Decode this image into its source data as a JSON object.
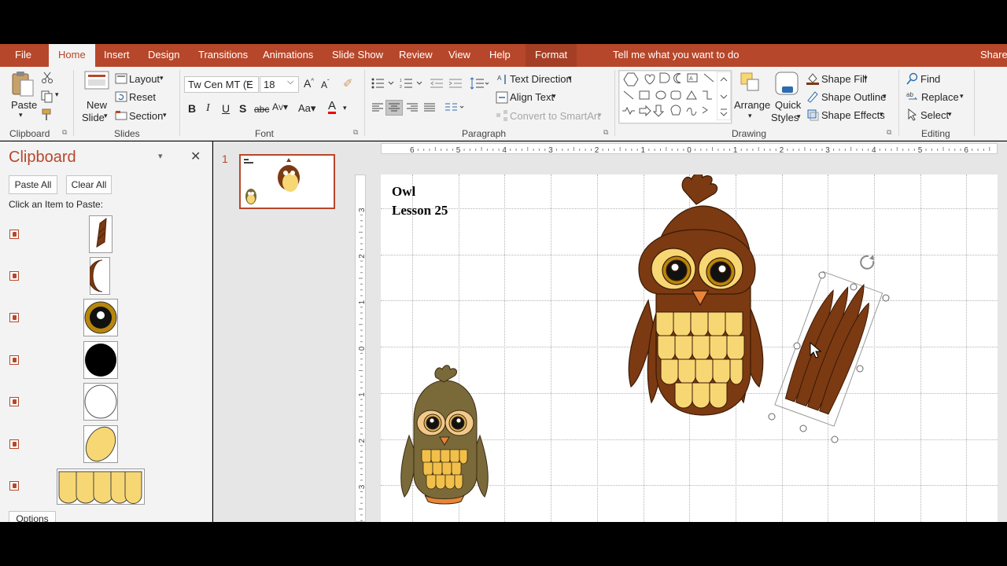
{
  "ribbon_tabs": [
    "File",
    "Home",
    "Insert",
    "Design",
    "Transitions",
    "Animations",
    "Slide Show",
    "Review",
    "View",
    "Help",
    "Format"
  ],
  "active_tab": "Home",
  "tell_me": "Tell me what you want to do",
  "share": "Share",
  "clipboard_group": {
    "paste": "Paste",
    "label": "Clipboard"
  },
  "slides_group": {
    "new_slide_1": "New",
    "new_slide_2": "Slide",
    "layout": "Layout",
    "reset": "Reset",
    "section": "Section",
    "label": "Slides"
  },
  "font_group": {
    "font_name": "Tw Cen MT (E",
    "font_size": "18",
    "label": "Font"
  },
  "paragraph_group": {
    "text_direction": "Text Direction",
    "align_text": "Align Text",
    "smartart": "Convert to SmartArt",
    "label": "Paragraph"
  },
  "drawing_group": {
    "arrange": "Arrange",
    "quick_styles_1": "Quick",
    "quick_styles_2": "Styles",
    "shape_fill": "Shape Fill",
    "shape_outline": "Shape Outline",
    "shape_effects": "Shape Effects",
    "label": "Drawing"
  },
  "editing_group": {
    "find": "Find",
    "replace": "Replace",
    "select": "Select",
    "label": "Editing"
  },
  "clipboard_pane": {
    "title": "Clipboard",
    "paste_all": "Paste All",
    "clear_all": "Clear All",
    "hint": "Click an Item to Paste:",
    "options": "Options"
  },
  "slide_number": "1",
  "slide": {
    "title_line1": "Owl",
    "title_line2": "Lesson 25"
  },
  "ruler_h": [
    "6",
    "5",
    "4",
    "3",
    "2",
    "1",
    "0",
    "1",
    "2",
    "3",
    "4",
    "5",
    "6"
  ],
  "ruler_v": [
    "3",
    "2",
    "1",
    "0",
    "1",
    "2",
    "3"
  ],
  "colors": {
    "accent": "#b7472a",
    "owl_brown": "#7b3a12",
    "owl_yellow": "#f7d774"
  }
}
